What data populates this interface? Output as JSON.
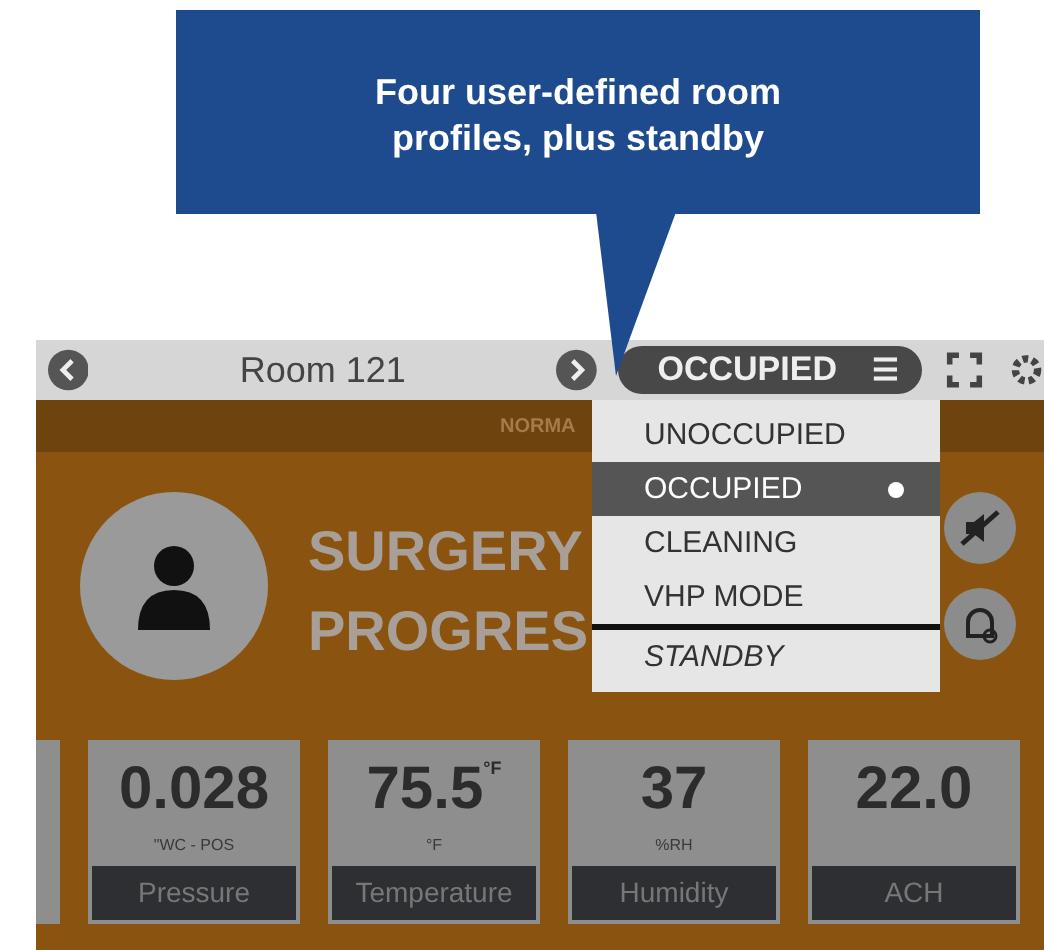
{
  "callout": {
    "text": "Four user-defined room profiles, plus standby"
  },
  "top_bar": {
    "room": "Room 121",
    "mode": "OCCUPIED",
    "menu_glyph": "☰"
  },
  "status_strip": "NORMA",
  "banner": [
    "SURGERY",
    "PROGRES"
  ],
  "mode_menu": [
    {
      "label": "UNOCCUPIED",
      "kind": "mode",
      "selected": false
    },
    {
      "label": "OCCUPIED",
      "kind": "mode",
      "selected": true
    },
    {
      "label": "CLEANING",
      "kind": "mode",
      "selected": false
    },
    {
      "label": "VHP MODE",
      "kind": "mode",
      "selected": false
    },
    {
      "label": "STANDBY",
      "kind": "standby",
      "selected": false
    }
  ],
  "sensors": [
    {
      "value": "0.028",
      "unit": "\"WC - POS",
      "label": "Pressure"
    },
    {
      "value": "75.5$^{°F}$",
      "unit": "°F",
      "label": "Temperature"
    },
    {
      "value": "37",
      "unit": "%RH",
      "label": "Humidity"
    },
    {
      "value": "22.0",
      "label": "ACH"
    }
  ]
}
